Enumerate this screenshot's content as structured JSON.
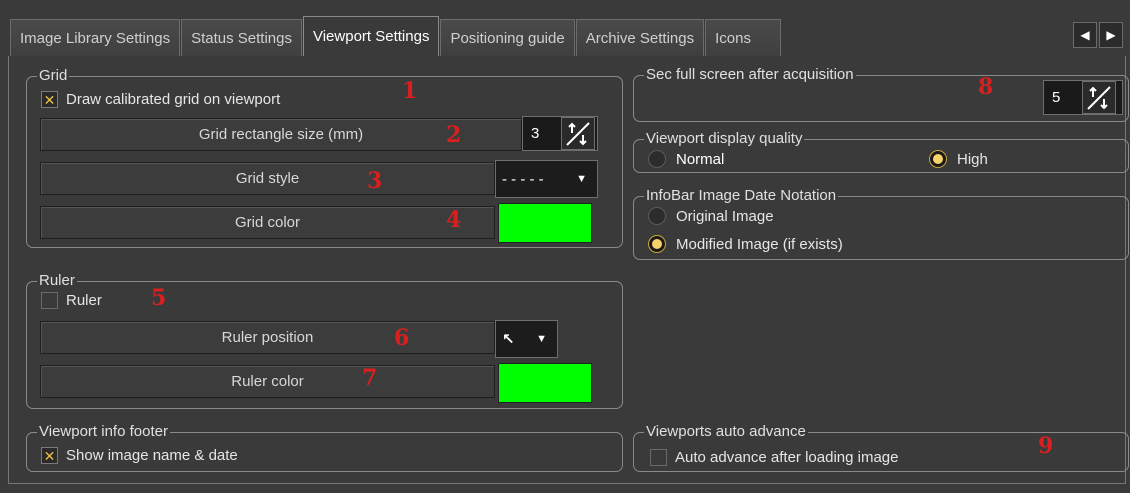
{
  "tabs": [
    {
      "label": "Image Library Settings"
    },
    {
      "label": "Status Settings"
    },
    {
      "label": "Viewport Settings"
    },
    {
      "label": "Positioning guide"
    },
    {
      "label": "Archive Settings"
    },
    {
      "label": "Icons"
    }
  ],
  "active_tab": "Viewport Settings",
  "nav": {
    "prev": "◀",
    "next": "▶"
  },
  "grid": {
    "title": "Grid",
    "draw_grid_label": "Draw calibrated grid on viewport",
    "draw_grid_checked": true,
    "rect_size_label": "Grid rectangle size (mm)",
    "rect_size_value": "3",
    "style_label": "Grid style",
    "style_value": "- - - - -",
    "color_label": "Grid color",
    "color_value": "#00ff00"
  },
  "ruler": {
    "title": "Ruler",
    "ruler_label": "Ruler",
    "ruler_checked": false,
    "position_label": "Ruler position",
    "position_value": "↖",
    "color_label": "Ruler color",
    "color_value": "#00ff00"
  },
  "footer": {
    "title": "Viewport info footer",
    "show_label": "Show image name & date",
    "show_checked": true
  },
  "fullscreen": {
    "title": "Sec full screen after acquisition",
    "value": "5"
  },
  "quality": {
    "title": "Viewport display quality",
    "options": [
      {
        "label": "Normal",
        "selected": false
      },
      {
        "label": "High",
        "selected": true
      }
    ]
  },
  "infobar": {
    "title": "InfoBar Image Date Notation",
    "options": [
      {
        "label": "Original Image",
        "selected": false
      },
      {
        "label": "Modified Image (if exists)",
        "selected": true
      }
    ]
  },
  "auto_advance": {
    "title": "Viewports auto advance",
    "label": "Auto advance after loading image",
    "checked": false
  },
  "markers": [
    "1",
    "2",
    "3",
    "4",
    "5",
    "6",
    "7",
    "8",
    "9"
  ],
  "icons": {
    "check": "✕",
    "caret": "▼",
    "spin_up": "↑",
    "spin_down": "↓"
  }
}
